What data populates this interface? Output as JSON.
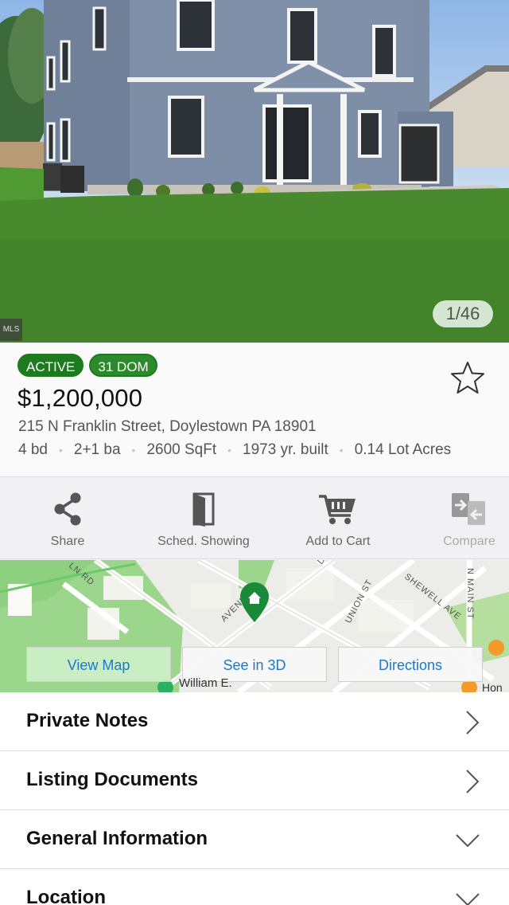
{
  "photo": {
    "counter": "1/46",
    "tag": "MLS"
  },
  "listing": {
    "badges": [
      "ACTIVE",
      "31 DOM"
    ],
    "price": "$1,200,000",
    "address": "215 N Franklin Street, Doylestown PA  18901",
    "stats": [
      "4 bd",
      "2+1 ba",
      "2600 SqFt",
      "1973 yr. built",
      "0.14 Lot Acres"
    ]
  },
  "actions": [
    {
      "label": "Share",
      "icon": "share-icon"
    },
    {
      "label": "Sched. Showing",
      "icon": "door-icon"
    },
    {
      "label": "Add to Cart",
      "icon": "cart-icon"
    },
    {
      "label": "Compare",
      "icon": "compare-icon"
    }
  ],
  "map": {
    "street_labels": [
      "LN RD",
      "AVENUE",
      "DE",
      "UNION ST",
      "SHEWELL AVE",
      "N MAIN ST",
      "William E.",
      "Hon"
    ],
    "buttons": {
      "view_map": "View Map",
      "see_3d": "See in 3D",
      "directions": "Directions"
    }
  },
  "sections": [
    {
      "label": "Private Notes",
      "icon": "chevron-right-icon"
    },
    {
      "label": "Listing Documents",
      "icon": "chevron-right-icon"
    },
    {
      "label": "General Information",
      "icon": "chevron-down-icon"
    },
    {
      "label": "Location",
      "icon": "chevron-down-icon"
    }
  ],
  "colors": {
    "badge_green": "#1e7a1e",
    "link_blue": "#1e78c8",
    "map_pin_green": "#1a8a3a"
  }
}
